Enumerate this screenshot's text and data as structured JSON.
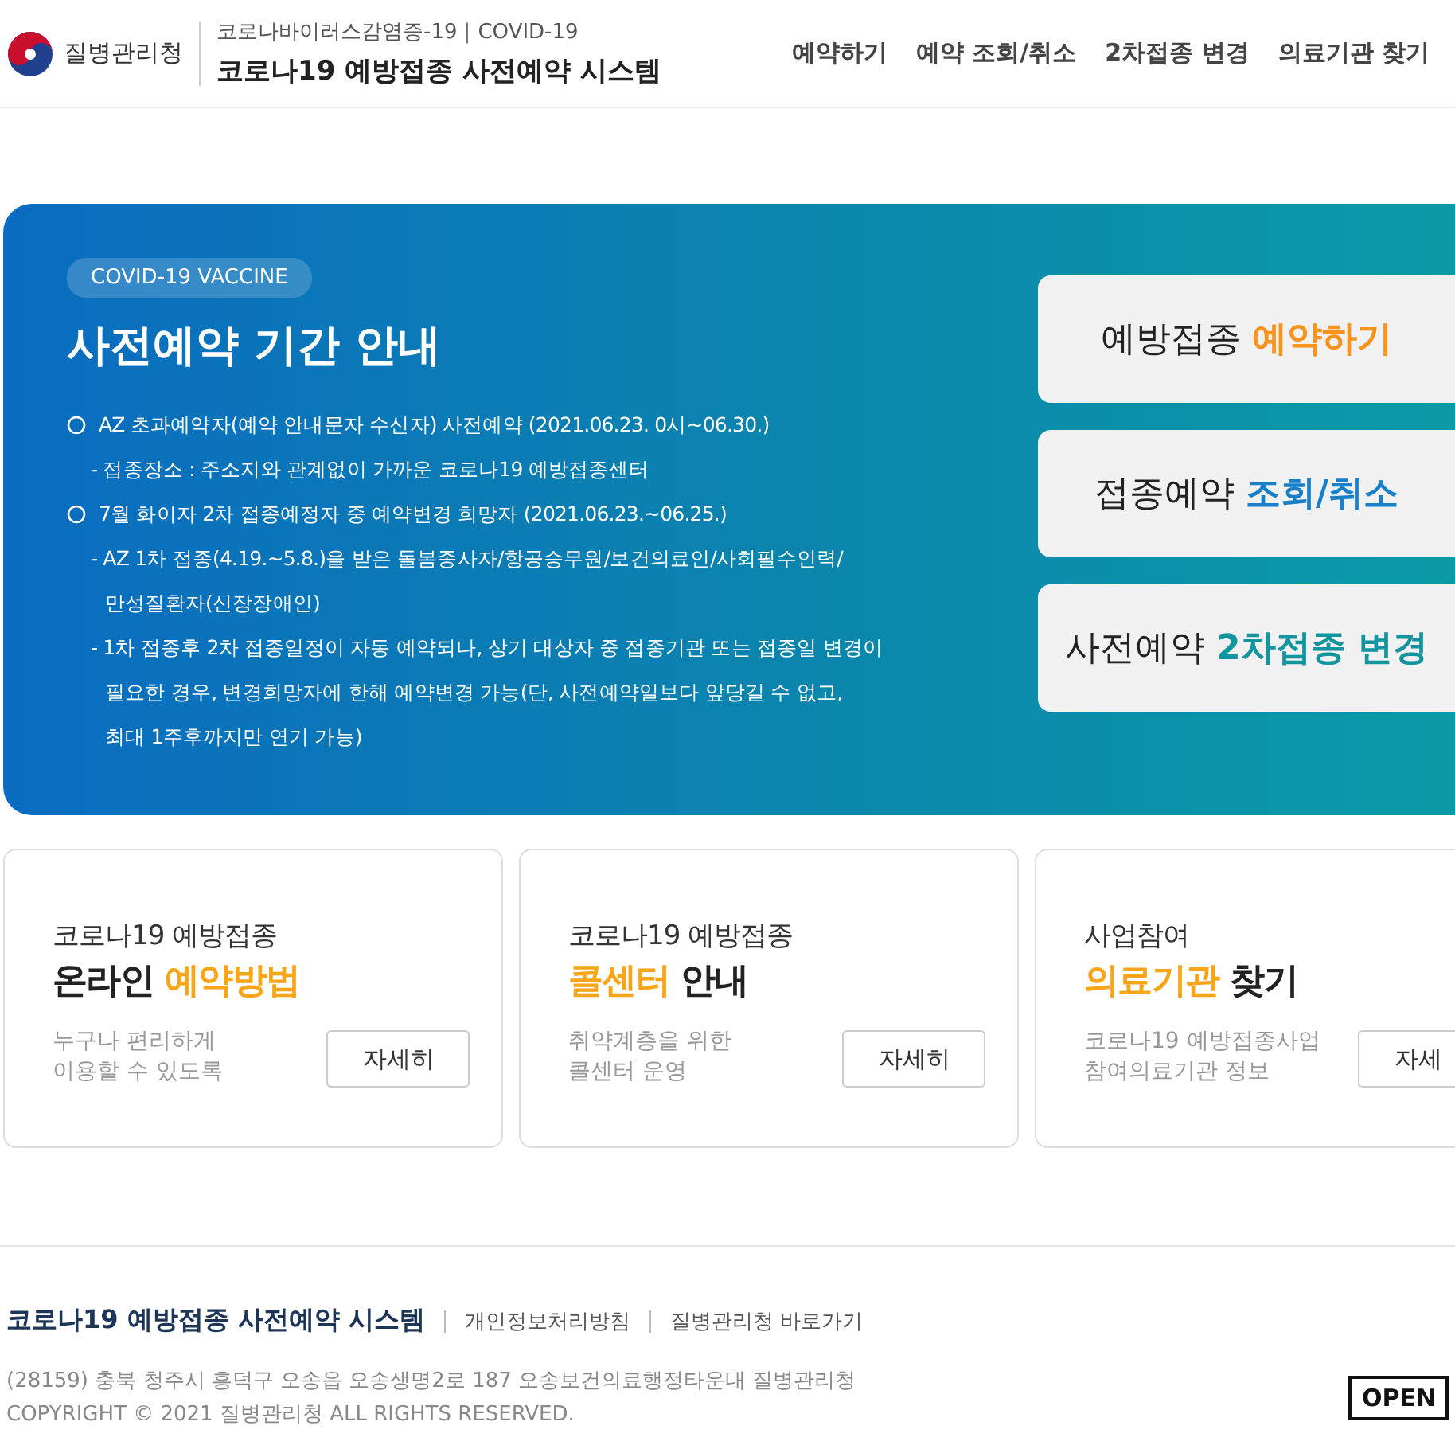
{
  "header": {
    "agency": "질병관리청",
    "subtitle": "코로나바이러스감염증-19｜COVID-19",
    "title": "코로나19 예방접종 사전예약 시스템",
    "nav": [
      {
        "label": "예약하기"
      },
      {
        "label": "예약 조회/취소"
      },
      {
        "label": "2차접종 변경"
      },
      {
        "label": "의료기관 찾기"
      }
    ]
  },
  "hero": {
    "badge": "COVID-19 VACCINE",
    "title": "사전예약 기간 안내",
    "notes": [
      {
        "kind": "circle",
        "text": "AZ 초과예약자(예약 안내문자 수신자) 사전예약 (2021.06.23. 0시~06.30.)"
      },
      {
        "kind": "dash",
        "text": "- 접종장소 : 주소지와 관계없이 가까운 코로나19 예방접종센터"
      },
      {
        "kind": "circle",
        "text": "7월 화이자 2차 접종예정자 중 예약변경 희망자 (2021.06.23.~06.25.)"
      },
      {
        "kind": "dash",
        "text": "- AZ 1차 접종(4.19.~5.8.)을 받은 돌봄종사자/항공승무원/보건의료인/사회필수인력/"
      },
      {
        "kind": "cont",
        "text": "만성질환자(신장장애인)"
      },
      {
        "kind": "dash",
        "text": "- 1차 접종후 2차 접종일정이 자동 예약되나, 상기 대상자 중 접종기관 또는 접종일 변경이"
      },
      {
        "kind": "cont",
        "text": "필요한 경우, 변경희망자에 한해 예약변경 가능(단, 사전예약일보다 앞당길 수 없고,"
      },
      {
        "kind": "cont",
        "text": "최대 1주후까지만 연기 가능)"
      }
    ],
    "actions": [
      {
        "prefix": "예방접종",
        "highlight": "예약하기",
        "color": "#f7931e"
      },
      {
        "prefix": "접종예약",
        "highlight": "조회/취소",
        "color": "#1a7fc9"
      },
      {
        "prefix": "사전예약",
        "highlight": "2차접종 변경",
        "color": "#13959f"
      }
    ]
  },
  "cards": [
    {
      "overline": "코로나19 예방접종",
      "title": [
        {
          "text": "온라인",
          "accent": false
        },
        {
          "text": "예약방법",
          "accent": true
        }
      ],
      "desc": [
        "누구나 편리하게",
        "이용할 수 있도록"
      ],
      "button": "자세히"
    },
    {
      "overline": "코로나19 예방접종",
      "title": [
        {
          "text": "콜센터",
          "accent": true
        },
        {
          "text": "안내",
          "accent": false
        }
      ],
      "desc": [
        "취약계층을 위한",
        "콜센터 운영"
      ],
      "button": "자세히"
    },
    {
      "overline": "사업참여",
      "title": [
        {
          "text": "의료기관",
          "accent": true
        },
        {
          "text": "찾기",
          "accent": false
        }
      ],
      "desc": [
        "코로나19 예방접종사업",
        "참여의료기관 정보"
      ],
      "button": "자세"
    }
  ],
  "footer": {
    "title": "코로나19 예방접종 사전예약 시스템",
    "links": [
      "개인정보처리방침",
      "질병관리청 바로가기"
    ],
    "address": "(28159) 충북 청주시 흥덕구 오송읍 오송생명2로 187 오송보건의료행정타운내 질병관리청",
    "copyright": "COPYRIGHT © 2021 질병관리청 ALL RIGHTS RESERVED.",
    "badge": "OPEN"
  }
}
